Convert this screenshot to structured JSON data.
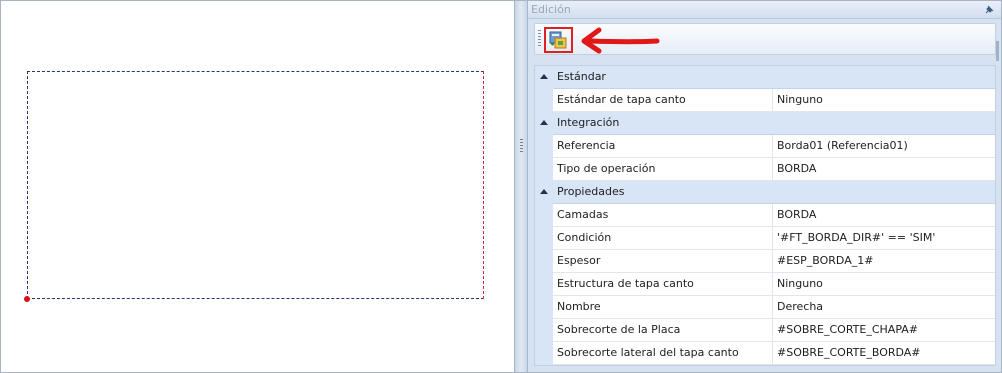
{
  "panel": {
    "title": "Edición"
  },
  "toolbar": {
    "add_button_icon": "add-component-icon",
    "highlight_color": "#e02020"
  },
  "property_grid": {
    "categories": [
      {
        "label": "Estándar",
        "properties": [
          {
            "name": "Estándar de tapa canto",
            "value": "Ninguno"
          }
        ]
      },
      {
        "label": "Integración",
        "properties": [
          {
            "name": "Referencia",
            "value": "Borda01 (Referencia01)"
          },
          {
            "name": "Tipo de operación",
            "value": "BORDA"
          }
        ]
      },
      {
        "label": "Propiedades",
        "properties": [
          {
            "name": "Camadas",
            "value": "BORDA"
          },
          {
            "name": "Condición",
            "value": "'#FT_BORDA_DIR#' == 'SIM'"
          },
          {
            "name": "Espesor",
            "value": "#ESP_BORDA_1#"
          },
          {
            "name": "Estructura de tapa canto",
            "value": "Ninguno"
          },
          {
            "name": "Nombre",
            "value": "Derecha"
          },
          {
            "name": "Sobrecorte de la Placa",
            "value": "#SOBRE_CORTE_CHAPA#"
          },
          {
            "name": "Sobrecorte lateral del tapa canto",
            "value": "#SOBRE_CORTE_BORDA#"
          }
        ]
      }
    ]
  },
  "colors": {
    "category_bg": "#d7e5f7",
    "panel_bg": "#d6e2f1",
    "shape_edge": "#1f3a6b",
    "shape_edge_selected": "#d0283a"
  }
}
